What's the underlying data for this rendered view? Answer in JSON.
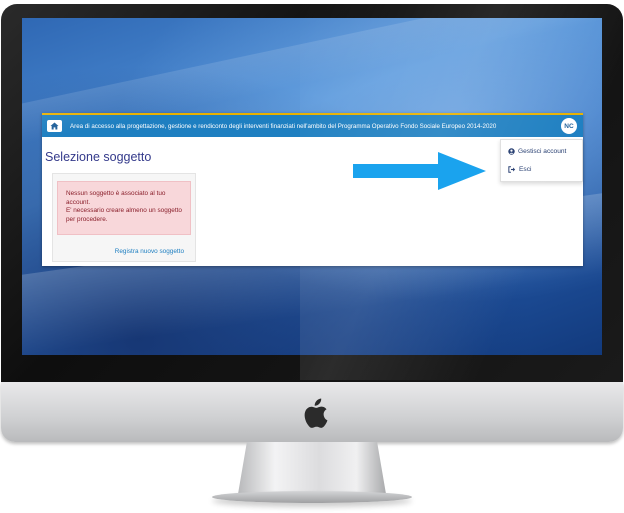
{
  "header": {
    "title": "Area di accesso alla progettazione, gestione e rendiconto degli interventi finanziati nell'ambito del Programma Operativo Fondo Sociale Europeo 2014-2020",
    "avatar_initials": "NC",
    "home_icon": "home-icon",
    "bar_color": "#1e7fc1",
    "accent_color": "#e8b100"
  },
  "page": {
    "title": "Selezione soggetto"
  },
  "alert": {
    "line1": "Nessun soggetto è associato al tuo account.",
    "line2": "E' necessario creare almeno un soggetto per procedere."
  },
  "card": {
    "register_link": "Registra nuovo soggetto"
  },
  "user_menu": {
    "items": [
      {
        "label": "Gestisci account",
        "icon": "user-circle-icon"
      },
      {
        "label": "Esci",
        "icon": "sign-out-icon"
      }
    ]
  },
  "annotation": {
    "arrow_color": "#1aa3ee"
  }
}
